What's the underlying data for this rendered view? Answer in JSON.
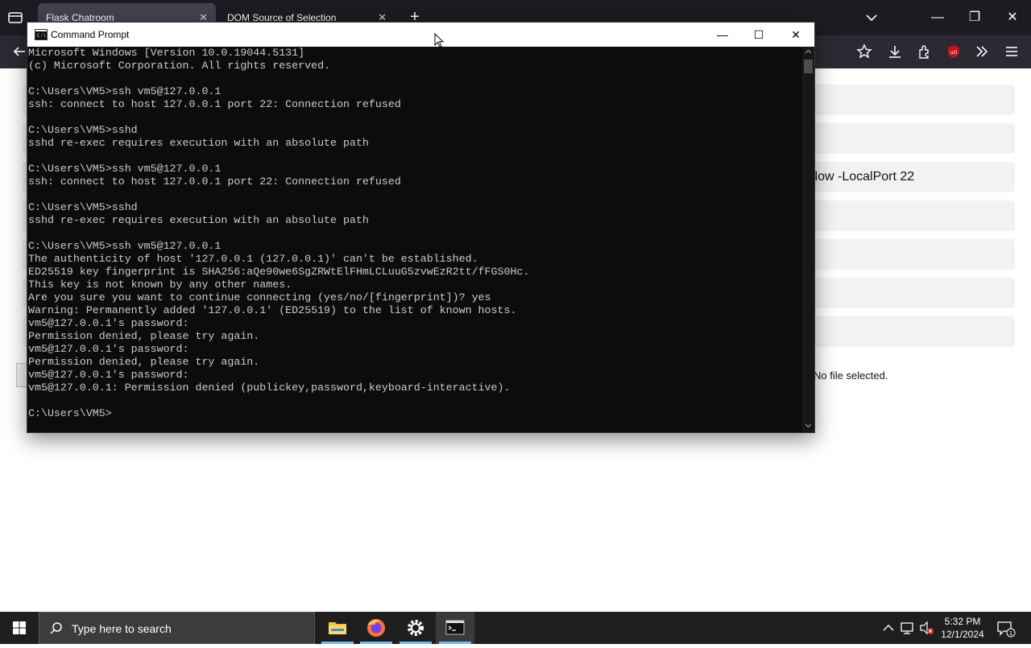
{
  "browser": {
    "tabs": [
      {
        "title": "Flask Chatroom",
        "active": true
      },
      {
        "title": "DOM Source of Selection",
        "active": false
      }
    ],
    "new_tab_symbol": "+",
    "tab_close_symbol": "✕",
    "window_controls": {
      "minimize": "—",
      "restore": "❐",
      "close": "✕"
    },
    "toolbar_icons": [
      "back-arrow-icon",
      "bookmark-star-icon",
      "download-icon",
      "extensions-icon",
      "ublock-icon",
      "overflow-chevrons-icon",
      "menu-icon"
    ]
  },
  "page": {
    "rows": [
      {
        "text": ""
      },
      {
        "text": ""
      },
      {
        "text": "llow -LocalPort 22"
      },
      {
        "text": ""
      },
      {
        "text": ""
      },
      {
        "text": ""
      },
      {
        "text": ""
      }
    ],
    "file_status": "No file selected."
  },
  "cmd": {
    "title": "Command Prompt",
    "controls": {
      "minimize": "—",
      "maximize": "☐",
      "close": "✕"
    },
    "lines": [
      "Microsoft Windows [Version 10.0.19044.5131]",
      "(c) Microsoft Corporation. All rights reserved.",
      "",
      "C:\\Users\\VM5>ssh vm5@127.0.0.1",
      "ssh: connect to host 127.0.0.1 port 22: Connection refused",
      "",
      "C:\\Users\\VM5>sshd",
      "sshd re-exec requires execution with an absolute path",
      "",
      "C:\\Users\\VM5>ssh vm5@127.0.0.1",
      "ssh: connect to host 127.0.0.1 port 22: Connection refused",
      "",
      "C:\\Users\\VM5>sshd",
      "sshd re-exec requires execution with an absolute path",
      "",
      "C:\\Users\\VM5>ssh vm5@127.0.0.1",
      "The authenticity of host '127.0.0.1 (127.0.0.1)' can't be established.",
      "ED25519 key fingerprint is SHA256:aQe90we6SgZRWtElFHmLCLuuG5zvwEzR2tt/fFGS0Hc.",
      "This key is not known by any other names.",
      "Are you sure you want to continue connecting (yes/no/[fingerprint])? yes",
      "Warning: Permanently added '127.0.0.1' (ED25519) to the list of known hosts.",
      "vm5@127.0.0.1's password:",
      "Permission denied, please try again.",
      "vm5@127.0.0.1's password:",
      "Permission denied, please try again.",
      "vm5@127.0.0.1's password:",
      "vm5@127.0.0.1: Permission denied (publickey,password,keyboard-interactive).",
      "",
      "C:\\Users\\VM5>"
    ]
  },
  "taskbar": {
    "search_placeholder": "Type here to search",
    "apps": [
      "file-explorer-icon",
      "firefox-icon",
      "settings-gear-icon",
      "command-prompt-icon"
    ],
    "time": "5:32 PM",
    "date": "12/1/2024",
    "notification_count": "1"
  },
  "colors": {
    "terminal_bg": "#0c0c0c",
    "terminal_text": "#cccccc",
    "browser_tabbar": "#1c1b22",
    "browser_toolbar": "#2b2a33",
    "taskbar": "#1f1f1f"
  }
}
